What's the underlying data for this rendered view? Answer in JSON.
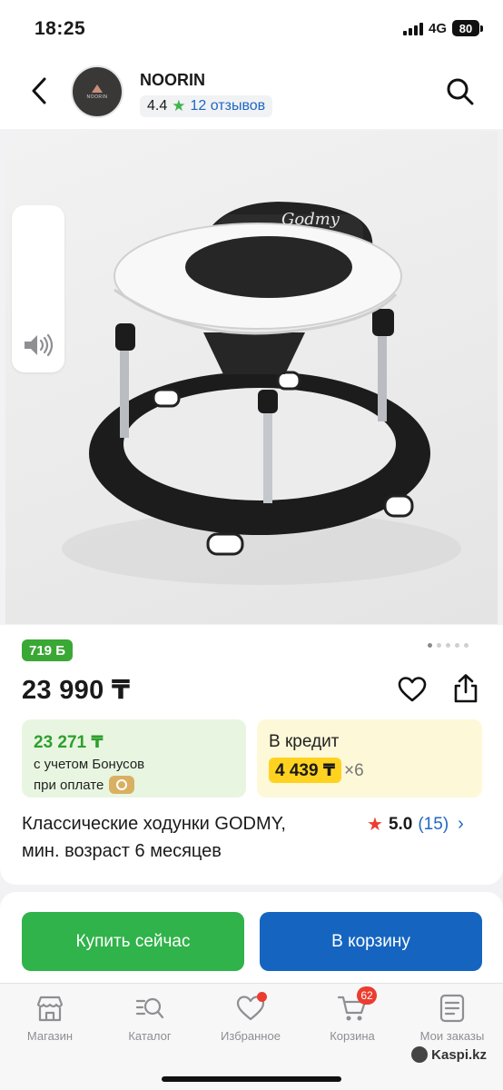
{
  "status_bar": {
    "time": "18:25",
    "network": "4G",
    "battery": "80"
  },
  "header": {
    "shop_name": "NOORIN",
    "logo_text": "NOORIN",
    "rating": "4.4",
    "reviews": "12 отзывов"
  },
  "gallery": {
    "image_brand_text": "Godmy",
    "dots_total": 5,
    "active_dot": 0
  },
  "product": {
    "bonus": "719 Б",
    "price": "23 990 ₸",
    "bonus_price": "23 271 ₸",
    "bonus_line1": "с учетом Бонусов",
    "bonus_line2": "при оплате",
    "credit_title": "В кредит",
    "credit_payment": "4 439 ₸",
    "credit_multiplier": "×6",
    "title_line1": "Классические ходунки GODMY,",
    "title_line2": "мин. возраст 6 месяцев",
    "rating": "5.0",
    "rating_count": "(15)"
  },
  "actions": {
    "buy_label": "Купить сейчас",
    "cart_label": "В корзину"
  },
  "tabbar": {
    "items": [
      {
        "label": "Магазин",
        "icon": "store-icon"
      },
      {
        "label": "Каталог",
        "icon": "catalog-search-icon"
      },
      {
        "label": "Избранное",
        "icon": "heart-icon"
      },
      {
        "label": "Корзина",
        "icon": "cart-icon"
      },
      {
        "label": "Мои заказы",
        "icon": "orders-icon"
      }
    ],
    "cart_count": "62"
  },
  "watermark": "Kaspi.kz",
  "colors": {
    "green": "#2fb34a",
    "blue": "#1565c0",
    "yellow": "#ffd21f",
    "red": "#ec3c30"
  }
}
